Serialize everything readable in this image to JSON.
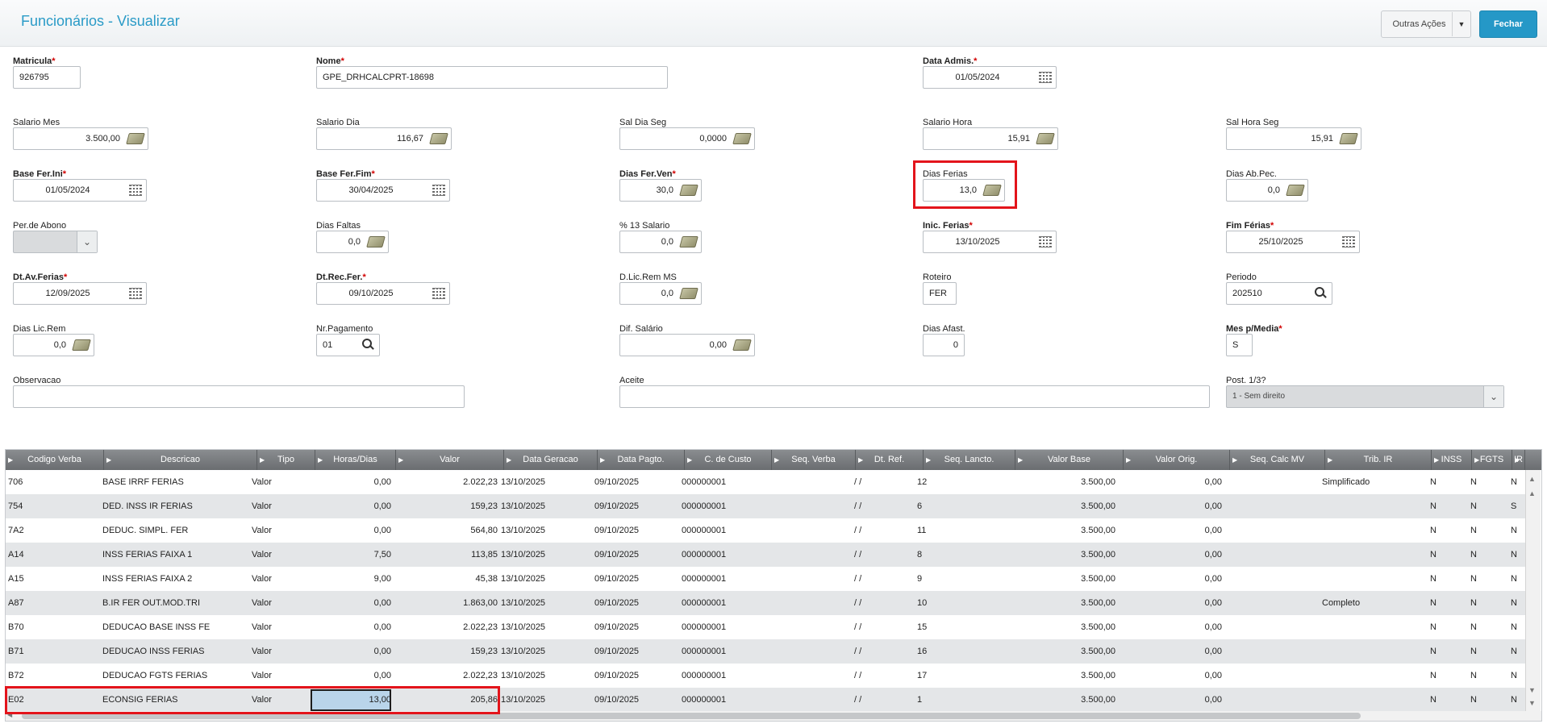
{
  "header": {
    "title": "Funcionários - Visualizar",
    "outras_acoes": "Outras Ações",
    "fechar": "Fechar"
  },
  "form": {
    "matricula": {
      "label": "Matricula",
      "value": "926795"
    },
    "nome": {
      "label": "Nome",
      "value": "GPE_DRHCALCPRT-18698"
    },
    "data_admis": {
      "label": "Data Admis.",
      "value": "01/05/2024"
    },
    "salario_mes": {
      "label": "Salario Mes",
      "value": "3.500,00"
    },
    "salario_dia": {
      "label": "Salario Dia",
      "value": "116,67"
    },
    "sal_dia_seg": {
      "label": "Sal Dia Seg",
      "value": "0,0000"
    },
    "salario_hora": {
      "label": "Salario Hora",
      "value": "15,91"
    },
    "sal_hora_seg": {
      "label": "Sal Hora Seg",
      "value": "15,91"
    },
    "base_fer_ini": {
      "label": "Base Fer.Ini",
      "value": "01/05/2024"
    },
    "base_fer_fim": {
      "label": "Base Fer.Fim",
      "value": "30/04/2025"
    },
    "dias_fer_ven": {
      "label": "Dias Fer.Ven",
      "value": "30,0"
    },
    "dias_ferias": {
      "label": "Dias Ferias",
      "value": "13,0"
    },
    "dias_ab_pec": {
      "label": "Dias Ab.Pec.",
      "value": "0,0"
    },
    "per_de_abono": {
      "label": "Per.de Abono",
      "value": ""
    },
    "dias_faltas": {
      "label": "Dias Faltas",
      "value": "0,0"
    },
    "pct_13_salario": {
      "label": "% 13 Salario",
      "value": "0,0"
    },
    "inic_ferias": {
      "label": "Inic. Ferias",
      "value": "13/10/2025"
    },
    "fim_ferias": {
      "label": "Fim Férias",
      "value": "25/10/2025"
    },
    "dt_av_ferias": {
      "label": "Dt.Av.Ferias",
      "value": "12/09/2025"
    },
    "dt_rec_fer": {
      "label": "Dt.Rec.Fer.",
      "value": "09/10/2025"
    },
    "d_lic_rem_ms": {
      "label": "D.Lic.Rem MS",
      "value": "0,0"
    },
    "roteiro": {
      "label": "Roteiro",
      "value": "FER"
    },
    "periodo": {
      "label": "Periodo",
      "value": "202510"
    },
    "dias_lic_rem": {
      "label": "Dias Lic.Rem",
      "value": "0,0"
    },
    "nr_pagamento": {
      "label": "Nr.Pagamento",
      "value": "01"
    },
    "dif_salario": {
      "label": "Dif. Salário",
      "value": "0,00"
    },
    "dias_afast": {
      "label": "Dias Afast.",
      "value": "0"
    },
    "mes_p_media": {
      "label": "Mes p/Media",
      "value": "S"
    },
    "observacao": {
      "label": "Observacao",
      "value": ""
    },
    "aceite": {
      "label": "Aceite",
      "value": ""
    },
    "post_1_3": {
      "label": "Post. 1/3?",
      "value": "1 - Sem direito"
    }
  },
  "grid": {
    "columns": [
      "Codigo Verba",
      "Descricao",
      "Tipo",
      "Horas/Dias",
      "Valor",
      "Data Geracao",
      "Data Pagto.",
      "C. de Custo",
      "Seq. Verba",
      "Dt. Ref.",
      "Seq. Lancto.",
      "Valor Base",
      "Valor Orig.",
      "Seq. Calc MV",
      "Trib. IR",
      "INSS",
      "FGTS",
      "IR"
    ],
    "rows": [
      [
        "706",
        "BASE IRRF FERIAS",
        "Valor",
        "0,00",
        "2.022,23",
        "13/10/2025",
        "09/10/2025",
        "000000001",
        "",
        "/ /",
        "12",
        "3.500,00",
        "0,00",
        "",
        "Simplificado",
        "N",
        "N",
        "N"
      ],
      [
        "754",
        "DED. INSS IR FERIAS",
        "Valor",
        "0,00",
        "159,23",
        "13/10/2025",
        "09/10/2025",
        "000000001",
        "",
        "/ /",
        "6",
        "3.500,00",
        "0,00",
        "",
        "",
        "N",
        "N",
        "S"
      ],
      [
        "7A2",
        "DEDUC. SIMPL. FER",
        "Valor",
        "0,00",
        "564,80",
        "13/10/2025",
        "09/10/2025",
        "000000001",
        "",
        "/ /",
        "11",
        "3.500,00",
        "0,00",
        "",
        "",
        "N",
        "N",
        "N"
      ],
      [
        "A14",
        "INSS FERIAS FAIXA 1",
        "Valor",
        "7,50",
        "113,85",
        "13/10/2025",
        "09/10/2025",
        "000000001",
        "",
        "/ /",
        "8",
        "3.500,00",
        "0,00",
        "",
        "",
        "N",
        "N",
        "N"
      ],
      [
        "A15",
        "INSS FERIAS FAIXA 2",
        "Valor",
        "9,00",
        "45,38",
        "13/10/2025",
        "09/10/2025",
        "000000001",
        "",
        "/ /",
        "9",
        "3.500,00",
        "0,00",
        "",
        "",
        "N",
        "N",
        "N"
      ],
      [
        "A87",
        "B.IR FER OUT.MOD.TRI",
        "Valor",
        "0,00",
        "1.863,00",
        "13/10/2025",
        "09/10/2025",
        "000000001",
        "",
        "/ /",
        "10",
        "3.500,00",
        "0,00",
        "",
        "Completo",
        "N",
        "N",
        "N"
      ],
      [
        "B70",
        "DEDUCAO BASE INSS FE",
        "Valor",
        "0,00",
        "2.022,23",
        "13/10/2025",
        "09/10/2025",
        "000000001",
        "",
        "/ /",
        "15",
        "3.500,00",
        "0,00",
        "",
        "",
        "N",
        "N",
        "N"
      ],
      [
        "B71",
        "DEDUCAO INSS FERIAS",
        "Valor",
        "0,00",
        "159,23",
        "13/10/2025",
        "09/10/2025",
        "000000001",
        "",
        "/ /",
        "16",
        "3.500,00",
        "0,00",
        "",
        "",
        "N",
        "N",
        "N"
      ],
      [
        "B72",
        "DEDUCAO FGTS FERIAS",
        "Valor",
        "0,00",
        "2.022,23",
        "13/10/2025",
        "09/10/2025",
        "000000001",
        "",
        "/ /",
        "17",
        "3.500,00",
        "0,00",
        "",
        "",
        "N",
        "N",
        "N"
      ],
      [
        "E02",
        "ECONSIG FERIAS",
        "Valor",
        "13,00",
        "205,86",
        "13/10/2025",
        "09/10/2025",
        "000000001",
        "",
        "/ /",
        "1",
        "3.500,00",
        "0,00",
        "",
        "",
        "N",
        "N",
        "N"
      ]
    ]
  },
  "icons": {
    "money": "money-icon",
    "calendar": "calendar-icon",
    "search": "search-icon"
  },
  "colors": {
    "accent": "#2598c7",
    "highlight": "#e3141b",
    "grid_header": "#7a7d80",
    "selected_cell": "#b9d4ea"
  }
}
